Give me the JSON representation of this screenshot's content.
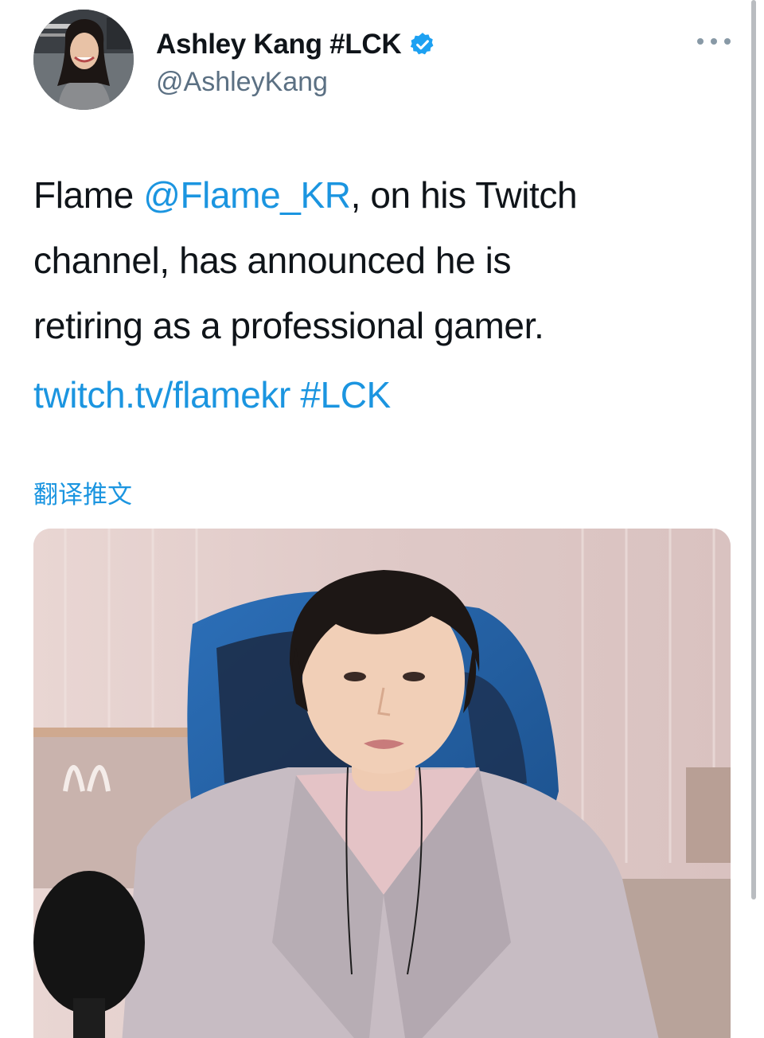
{
  "author": {
    "display_name": "Ashley Kang #LCK",
    "handle": "@AshleyKang",
    "verified": true,
    "avatar_icon": "profile-photo"
  },
  "tweet": {
    "text_before_mention": "Flame ",
    "mention": "@Flame_KR",
    "text_line1_rest": ", on his Twitch",
    "text_line2": "channel, has announced he is",
    "text_line3": "retiring as a professional gamer.",
    "link": "twitch.tv/flamekr",
    "hashtag": "#LCK"
  },
  "translate_label": "翻译推文",
  "menu_icon": "more-options-icon",
  "colors": {
    "accent": "#1b95e0",
    "text": "#0f1419",
    "secondary": "#5b7083",
    "verified": "#1da1f2"
  }
}
